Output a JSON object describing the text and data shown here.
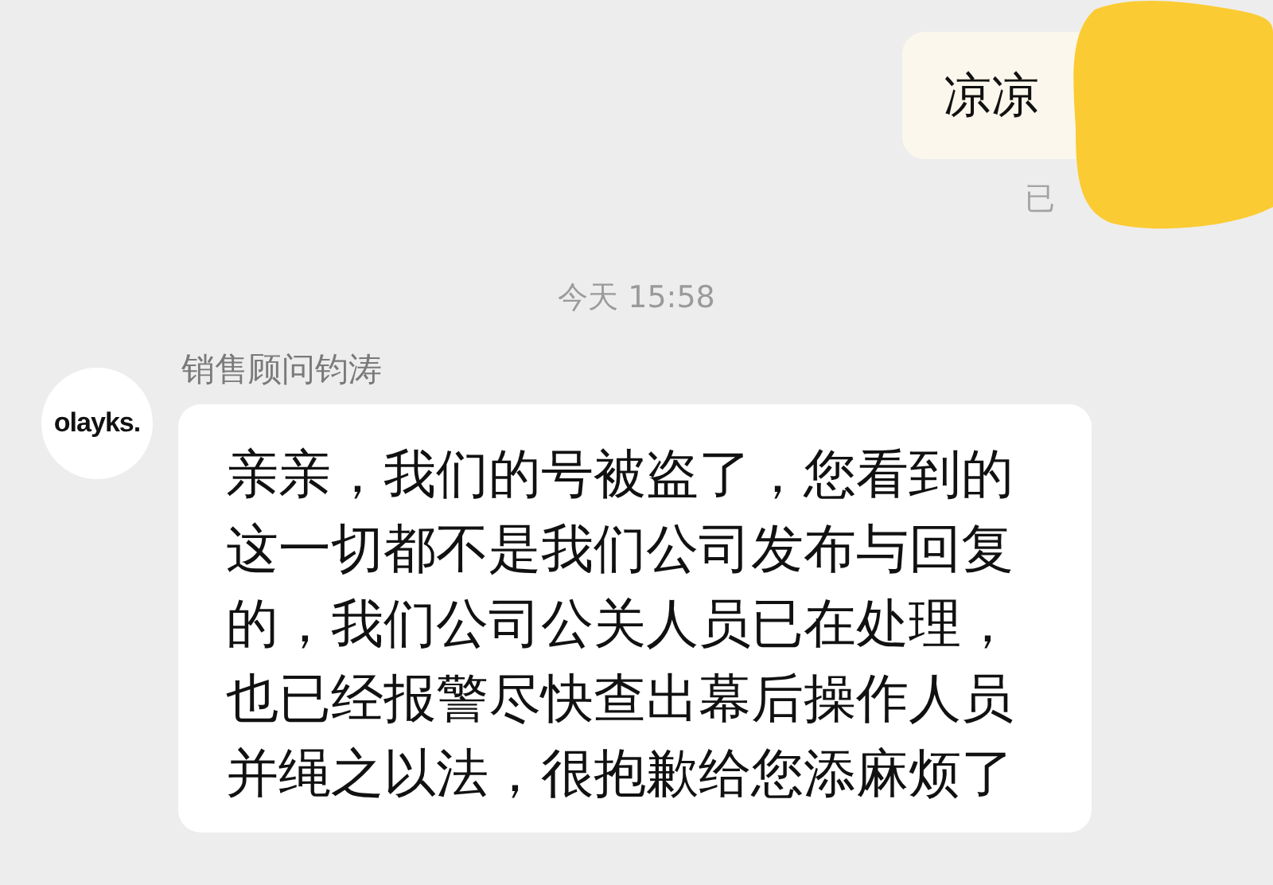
{
  "outgoing": {
    "text": "凉凉",
    "status": "已"
  },
  "time_divider": "今天 15:58",
  "incoming": {
    "avatar_label": "olayks.",
    "sender": "销售顾问钧涛",
    "text": "亲亲，我们的号被盗了，您看到的这一切都不是我们公司发布与回复的，我们公司公关人员已在处理，也已经报警尽快查出幕后操作人员并绳之以法，很抱歉给您添麻烦了"
  }
}
